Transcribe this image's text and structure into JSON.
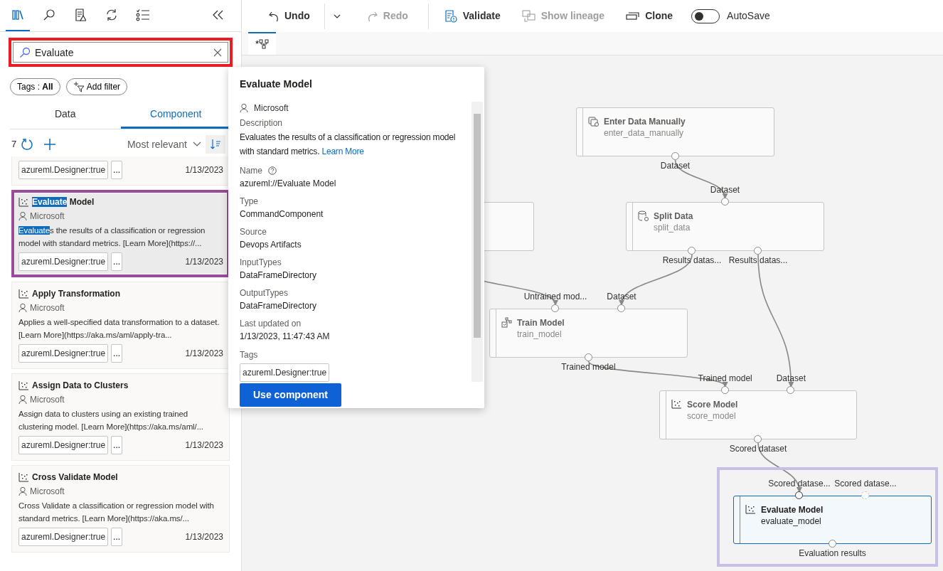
{
  "sidebar_tabs": [
    {
      "kind": "library",
      "selected": true
    },
    {
      "kind": "search",
      "selected": false
    },
    {
      "kind": "report",
      "selected": false
    },
    {
      "kind": "refresh",
      "selected": false
    },
    {
      "kind": "checklist",
      "selected": false
    }
  ],
  "search": {
    "value": "Evaluate",
    "highlighted": true
  },
  "filters": [
    {
      "kind": "tags",
      "label": "Tags : **All**"
    },
    {
      "kind": "add",
      "label": "Add filter"
    }
  ],
  "tabs": [
    {
      "label": "Data",
      "selected": false
    },
    {
      "label": "Component",
      "selected": true
    }
  ],
  "results": {
    "count": "7",
    "sort": "Most relevant"
  },
  "components": [
    {
      "kind": "cut",
      "tag": "azureml.Designer:true",
      "more": "...",
      "date": "1/13/2023",
      "selected": false,
      "highlighted": false
    },
    {
      "kind": "full",
      "title": [
        {
          "text": "Evaluate",
          "match": true
        },
        {
          "text": " Model",
          "match": false
        }
      ],
      "author": "Microsoft",
      "description": [
        {
          "text": "Evaluate",
          "match": true
        },
        {
          "text": "s the results of a classification or regression model with standard metrics. [Learn More](https://...",
          "match": false
        }
      ],
      "tag": "azureml.Designer:true",
      "more": "...",
      "date": "1/13/2023",
      "selected": true,
      "highlighted": true
    },
    {
      "kind": "full",
      "title": [
        {
          "text": "Apply Transformation",
          "match": false
        }
      ],
      "author": "Microsoft",
      "description": [
        {
          "text": "Applies a well-specified data transformation to a dataset. [Learn More](https://aka.ms/aml/apply-tra...",
          "match": false
        }
      ],
      "tag": "azureml.Designer:true",
      "more": "...",
      "date": "1/13/2023",
      "selected": false,
      "highlighted": false
    },
    {
      "kind": "full",
      "title": [
        {
          "text": "Assign Data to Clusters",
          "match": false
        }
      ],
      "author": "Microsoft",
      "description": [
        {
          "text": "Assign data to clusters using an existing trained clustering model. [Learn More](https://aka.ms/aml/...",
          "match": false
        }
      ],
      "tag": "azureml.Designer:true",
      "more": "...",
      "date": "1/13/2023",
      "selected": false,
      "highlighted": false
    },
    {
      "kind": "full",
      "title": [
        {
          "text": "Cross Validate Model",
          "match": false
        }
      ],
      "author": "Microsoft",
      "description": [
        {
          "text": "Cross Validate a classification or regression model with standard metrics. [Learn More](https://aka.ms/...",
          "match": false
        }
      ],
      "tag": "azureml.Designer:true",
      "more": "...",
      "date": "1/13/2023",
      "selected": false,
      "highlighted": false
    }
  ],
  "popup": {
    "title": "Evaluate Model",
    "author": "Microsoft",
    "description_label": "Description",
    "description": "Evaluates the results of a classification or regression model with standard metrics.",
    "link": "Learn More",
    "fields": [
      {
        "label": "Name",
        "value": "azureml://Evaluate Model",
        "help": true
      },
      {
        "label": "Type",
        "value": "CommandComponent",
        "help": false
      },
      {
        "label": "Source",
        "value": "Devops Artifacts",
        "help": false
      },
      {
        "label": "InputTypes",
        "value": "DataFrameDirectory",
        "help": false
      },
      {
        "label": "OutputTypes",
        "value": "DataFrameDirectory",
        "help": false
      },
      {
        "label": "Last updated on",
        "value": "1/13/2023, 11:47:43 AM",
        "help": false
      }
    ],
    "tags_label": "Tags",
    "tags": [
      "azureml.Designer:true"
    ],
    "button": "Use component"
  },
  "toolbar": [
    {
      "kind": "undo",
      "label": "Undo",
      "disabled": false
    },
    {
      "kind": "menu",
      "disabled": false
    },
    {
      "kind": "redo",
      "label": "Redo",
      "disabled": true
    },
    {
      "kind": "separator"
    },
    {
      "kind": "validate",
      "label": "Validate",
      "disabled": false
    },
    {
      "kind": "lineage",
      "label": "Show lineage",
      "disabled": true
    },
    {
      "kind": "clone",
      "label": "Clone",
      "disabled": false
    },
    {
      "kind": "toggle",
      "label": "AutoSave",
      "on": false
    }
  ],
  "canvas_tabs": [
    {
      "label": "*",
      "selected": true
    }
  ],
  "nodes": [
    {
      "kind": "data",
      "title": "Enter Data Manually",
      "name": "enter_data_manually",
      "selected": false,
      "highlighted": false,
      "outputs": [
        {
          "label": "Dataset"
        }
      ]
    },
    {
      "kind": "blank",
      "selected": false,
      "highlighted": false
    },
    {
      "kind": "split",
      "title": "Split Data",
      "name": "split_data",
      "selected": false,
      "highlighted": false,
      "inputs": [
        {
          "label": "Dataset",
          "connected": true
        }
      ],
      "outputs": [
        {
          "label": "Results datas..."
        },
        {
          "label": "Results datas..."
        }
      ]
    },
    {
      "kind": "train",
      "title": "Train Model",
      "name": "train_model",
      "selected": false,
      "highlighted": false,
      "inputs": [
        {
          "label": "Untrained mod...",
          "connected": true
        },
        {
          "label": "Dataset",
          "connected": true
        }
      ],
      "outputs": [
        {
          "label": "Trained model"
        }
      ]
    },
    {
      "kind": "chart",
      "title": "Score Model",
      "name": "score_model",
      "selected": false,
      "highlighted": false,
      "inputs": [
        {
          "label": "Trained model",
          "connected": true
        },
        {
          "label": "Dataset",
          "connected": true
        }
      ],
      "outputs": [
        {
          "label": "Scored dataset"
        }
      ]
    },
    {
      "kind": "chart",
      "title": "Evaluate Model",
      "name": "evaluate_model",
      "selected": true,
      "highlighted": true,
      "inputs": [
        {
          "label": "Scored datase...",
          "connected": true
        },
        {
          "label": "Scored datase...",
          "connected": false
        }
      ],
      "outputs": [
        {
          "label": "Evaluation results"
        }
      ]
    }
  ]
}
